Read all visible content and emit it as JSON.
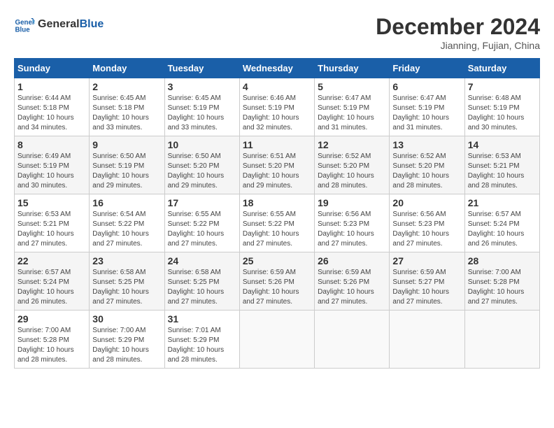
{
  "header": {
    "logo_line1": "General",
    "logo_line2": "Blue",
    "month_title": "December 2024",
    "location": "Jianning, Fujian, China"
  },
  "weekdays": [
    "Sunday",
    "Monday",
    "Tuesday",
    "Wednesday",
    "Thursday",
    "Friday",
    "Saturday"
  ],
  "weeks": [
    [
      {
        "day": "1",
        "sunrise": "Sunrise: 6:44 AM",
        "sunset": "Sunset: 5:18 PM",
        "daylight": "Daylight: 10 hours and 34 minutes."
      },
      {
        "day": "2",
        "sunrise": "Sunrise: 6:45 AM",
        "sunset": "Sunset: 5:18 PM",
        "daylight": "Daylight: 10 hours and 33 minutes."
      },
      {
        "day": "3",
        "sunrise": "Sunrise: 6:45 AM",
        "sunset": "Sunset: 5:19 PM",
        "daylight": "Daylight: 10 hours and 33 minutes."
      },
      {
        "day": "4",
        "sunrise": "Sunrise: 6:46 AM",
        "sunset": "Sunset: 5:19 PM",
        "daylight": "Daylight: 10 hours and 32 minutes."
      },
      {
        "day": "5",
        "sunrise": "Sunrise: 6:47 AM",
        "sunset": "Sunset: 5:19 PM",
        "daylight": "Daylight: 10 hours and 31 minutes."
      },
      {
        "day": "6",
        "sunrise": "Sunrise: 6:47 AM",
        "sunset": "Sunset: 5:19 PM",
        "daylight": "Daylight: 10 hours and 31 minutes."
      },
      {
        "day": "7",
        "sunrise": "Sunrise: 6:48 AM",
        "sunset": "Sunset: 5:19 PM",
        "daylight": "Daylight: 10 hours and 30 minutes."
      }
    ],
    [
      {
        "day": "8",
        "sunrise": "Sunrise: 6:49 AM",
        "sunset": "Sunset: 5:19 PM",
        "daylight": "Daylight: 10 hours and 30 minutes."
      },
      {
        "day": "9",
        "sunrise": "Sunrise: 6:50 AM",
        "sunset": "Sunset: 5:19 PM",
        "daylight": "Daylight: 10 hours and 29 minutes."
      },
      {
        "day": "10",
        "sunrise": "Sunrise: 6:50 AM",
        "sunset": "Sunset: 5:20 PM",
        "daylight": "Daylight: 10 hours and 29 minutes."
      },
      {
        "day": "11",
        "sunrise": "Sunrise: 6:51 AM",
        "sunset": "Sunset: 5:20 PM",
        "daylight": "Daylight: 10 hours and 29 minutes."
      },
      {
        "day": "12",
        "sunrise": "Sunrise: 6:52 AM",
        "sunset": "Sunset: 5:20 PM",
        "daylight": "Daylight: 10 hours and 28 minutes."
      },
      {
        "day": "13",
        "sunrise": "Sunrise: 6:52 AM",
        "sunset": "Sunset: 5:20 PM",
        "daylight": "Daylight: 10 hours and 28 minutes."
      },
      {
        "day": "14",
        "sunrise": "Sunrise: 6:53 AM",
        "sunset": "Sunset: 5:21 PM",
        "daylight": "Daylight: 10 hours and 28 minutes."
      }
    ],
    [
      {
        "day": "15",
        "sunrise": "Sunrise: 6:53 AM",
        "sunset": "Sunset: 5:21 PM",
        "daylight": "Daylight: 10 hours and 27 minutes."
      },
      {
        "day": "16",
        "sunrise": "Sunrise: 6:54 AM",
        "sunset": "Sunset: 5:22 PM",
        "daylight": "Daylight: 10 hours and 27 minutes."
      },
      {
        "day": "17",
        "sunrise": "Sunrise: 6:55 AM",
        "sunset": "Sunset: 5:22 PM",
        "daylight": "Daylight: 10 hours and 27 minutes."
      },
      {
        "day": "18",
        "sunrise": "Sunrise: 6:55 AM",
        "sunset": "Sunset: 5:22 PM",
        "daylight": "Daylight: 10 hours and 27 minutes."
      },
      {
        "day": "19",
        "sunrise": "Sunrise: 6:56 AM",
        "sunset": "Sunset: 5:23 PM",
        "daylight": "Daylight: 10 hours and 27 minutes."
      },
      {
        "day": "20",
        "sunrise": "Sunrise: 6:56 AM",
        "sunset": "Sunset: 5:23 PM",
        "daylight": "Daylight: 10 hours and 27 minutes."
      },
      {
        "day": "21",
        "sunrise": "Sunrise: 6:57 AM",
        "sunset": "Sunset: 5:24 PM",
        "daylight": "Daylight: 10 hours and 26 minutes."
      }
    ],
    [
      {
        "day": "22",
        "sunrise": "Sunrise: 6:57 AM",
        "sunset": "Sunset: 5:24 PM",
        "daylight": "Daylight: 10 hours and 26 minutes."
      },
      {
        "day": "23",
        "sunrise": "Sunrise: 6:58 AM",
        "sunset": "Sunset: 5:25 PM",
        "daylight": "Daylight: 10 hours and 27 minutes."
      },
      {
        "day": "24",
        "sunrise": "Sunrise: 6:58 AM",
        "sunset": "Sunset: 5:25 PM",
        "daylight": "Daylight: 10 hours and 27 minutes."
      },
      {
        "day": "25",
        "sunrise": "Sunrise: 6:59 AM",
        "sunset": "Sunset: 5:26 PM",
        "daylight": "Daylight: 10 hours and 27 minutes."
      },
      {
        "day": "26",
        "sunrise": "Sunrise: 6:59 AM",
        "sunset": "Sunset: 5:26 PM",
        "daylight": "Daylight: 10 hours and 27 minutes."
      },
      {
        "day": "27",
        "sunrise": "Sunrise: 6:59 AM",
        "sunset": "Sunset: 5:27 PM",
        "daylight": "Daylight: 10 hours and 27 minutes."
      },
      {
        "day": "28",
        "sunrise": "Sunrise: 7:00 AM",
        "sunset": "Sunset: 5:28 PM",
        "daylight": "Daylight: 10 hours and 27 minutes."
      }
    ],
    [
      {
        "day": "29",
        "sunrise": "Sunrise: 7:00 AM",
        "sunset": "Sunset: 5:28 PM",
        "daylight": "Daylight: 10 hours and 28 minutes."
      },
      {
        "day": "30",
        "sunrise": "Sunrise: 7:00 AM",
        "sunset": "Sunset: 5:29 PM",
        "daylight": "Daylight: 10 hours and 28 minutes."
      },
      {
        "day": "31",
        "sunrise": "Sunrise: 7:01 AM",
        "sunset": "Sunset: 5:29 PM",
        "daylight": "Daylight: 10 hours and 28 minutes."
      },
      null,
      null,
      null,
      null
    ]
  ]
}
